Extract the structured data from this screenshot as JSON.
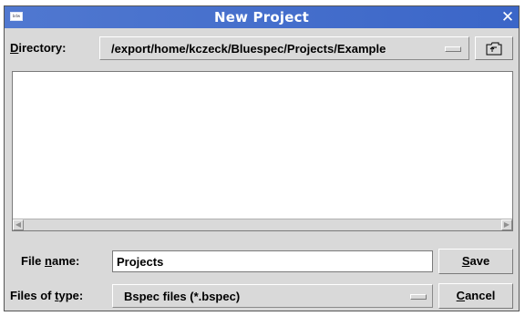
{
  "window": {
    "title": "New Project",
    "icon": "window-menu-icon",
    "icon_text": "bdw",
    "close_glyph": "✕"
  },
  "directory": {
    "label_prefix": "",
    "label_mnemonic": "D",
    "label_rest": "irectory:",
    "value": "/export/home/kczeck/Bluespec/Projects/Example",
    "up_icon": "up-folder-icon"
  },
  "file_list": {
    "items": [],
    "scroll_left_glyph": "◀",
    "scroll_right_glyph": "▶"
  },
  "file_name": {
    "label_prefix": "File ",
    "label_mnemonic": "n",
    "label_rest": "ame:",
    "value": "Projects"
  },
  "file_type": {
    "label_prefix": "Files of ",
    "label_mnemonic": "t",
    "label_rest": "ype:",
    "value": "Bspec files (*.bspec)"
  },
  "buttons": {
    "save_mnemonic": "S",
    "save_rest": "ave",
    "cancel_mnemonic": "C",
    "cancel_rest": "ancel"
  },
  "colors": {
    "titlebar": "#3b66c8",
    "dialog_bg": "#d9d9d9",
    "field_bg": "#ffffff"
  }
}
